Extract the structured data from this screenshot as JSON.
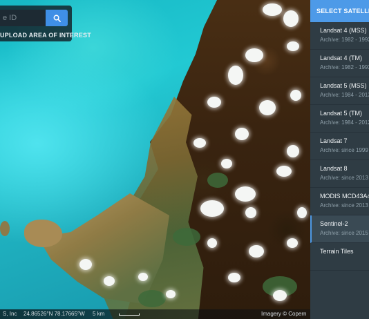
{
  "search": {
    "placeholder": "e ID",
    "button_icon": "search-icon",
    "upload_label": "UPLOAD AREA OF INTEREST"
  },
  "status": {
    "attribution_left": "S, Inc",
    "coordinates": "24.86526°N 78.17665°W",
    "scale": "5 km",
    "imagery_credit": "Imagery © Copern"
  },
  "sidebar": {
    "header": "SELECT SATELLITE",
    "items": [
      {
        "name": "Landsat 4 (MSS)",
        "archive": "Archive: 1982 - 1992"
      },
      {
        "name": "Landsat 4 (TM)",
        "archive": "Archive: 1982 - 1993"
      },
      {
        "name": "Landsat 5 (MSS)",
        "archive": "Archive: 1984 - 2013"
      },
      {
        "name": "Landsat 5 (TM)",
        "archive": "Archive: 1984 - 2012"
      },
      {
        "name": "Landsat 7",
        "archive": "Archive: since 1999"
      },
      {
        "name": "Landsat 8",
        "archive": "Archive: since 2013"
      },
      {
        "name": "MODIS MCD43A4",
        "archive": "Archive: since 2013"
      },
      {
        "name": "Sentinel-2",
        "archive": "Archive: since 2015",
        "selected": true
      },
      {
        "name": "Terrain Tiles",
        "archive": ""
      }
    ]
  },
  "colors": {
    "accent": "#4d9ae8",
    "sidebar_bg": "#2f3c44"
  }
}
